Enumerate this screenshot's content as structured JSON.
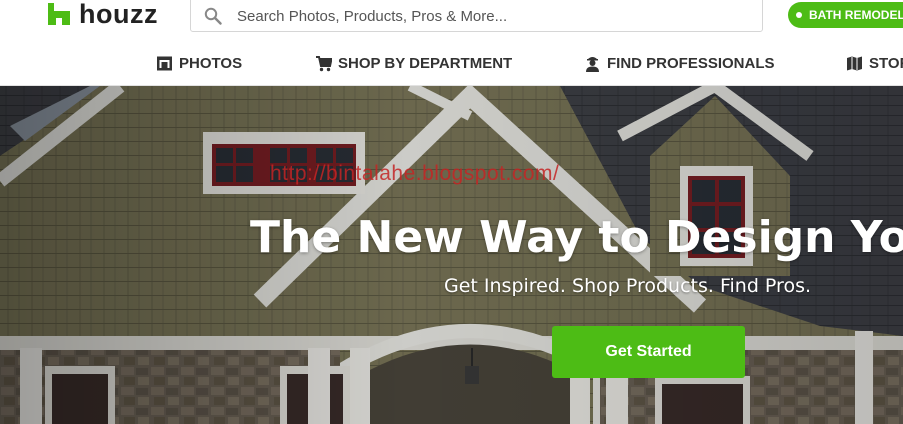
{
  "header": {
    "logo_text": "houzz",
    "search": {
      "placeholder": "Search Photos, Products, Pros & More...",
      "value": ""
    },
    "promo_label": "BATH REMODEL"
  },
  "nav": {
    "items": [
      {
        "label": "PHOTOS",
        "icon": "photo-icon"
      },
      {
        "label": "SHOP BY DEPARTMENT",
        "icon": "shopping-cart-icon"
      },
      {
        "label": "FIND PROFESSIONALS",
        "icon": "professional-icon"
      },
      {
        "label": "STOR",
        "icon": "map-icon"
      }
    ]
  },
  "hero": {
    "watermark": "http://bintalahe.blogspot.com/",
    "headline": "The New Way to Design Your",
    "subheadline": "Get Inspired. Shop Products. Find Pros.",
    "cta_label": "Get Started"
  },
  "colors": {
    "brand_green": "#4dbc15",
    "nav_text": "#333333",
    "watermark_red": "#c42424"
  }
}
